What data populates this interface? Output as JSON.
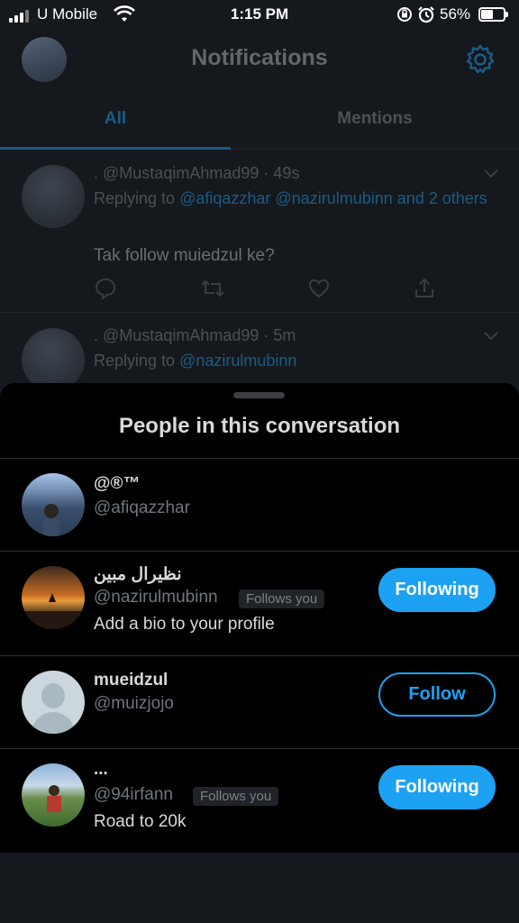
{
  "status_bar": {
    "carrier": "U Mobile",
    "time": "1:15 PM",
    "battery_percent": "56%",
    "battery_level": 0.56
  },
  "header": {
    "title": "Notifications"
  },
  "tabs": [
    {
      "label": "All",
      "selected": true
    },
    {
      "label": "Mentions",
      "selected": false
    }
  ],
  "notifications": [
    {
      "name": ".",
      "handle": "@MustaqimAhmad99",
      "time": "49s",
      "replying_prefix": "Replying to",
      "mentions": "@afiqazzhar @nazirulmubinn and 2 others",
      "text": "Tak follow muiedzul ke?"
    },
    {
      "name": ".",
      "handle": "@MustaqimAhmad99",
      "time": "5m",
      "replying_prefix": "Replying to",
      "mentions": "@nazirulmubinn"
    }
  ],
  "sheet": {
    "title": "People in this conversation",
    "people": [
      {
        "name": "@®™",
        "handle": "@afiqazzhar",
        "follows_you": false,
        "bio": "",
        "button": ""
      },
      {
        "name": "نظيرال مبين",
        "handle": "@nazirulmubinn",
        "follows_you": true,
        "follows_label": "Follows you",
        "bio": "Add a bio to your profile",
        "button": "Following"
      },
      {
        "name": "mueidzul",
        "handle": "@muizjojo",
        "follows_you": false,
        "bio": "",
        "button": "Follow"
      },
      {
        "name": "...",
        "handle": "@94irfann",
        "follows_you": true,
        "follows_label": "Follows you",
        "bio": "Road to 20k",
        "button": "Following"
      }
    ]
  },
  "colors": {
    "accent": "#1da1f2",
    "sheet_bg": "#000000",
    "screen_bg": "#15181c"
  }
}
